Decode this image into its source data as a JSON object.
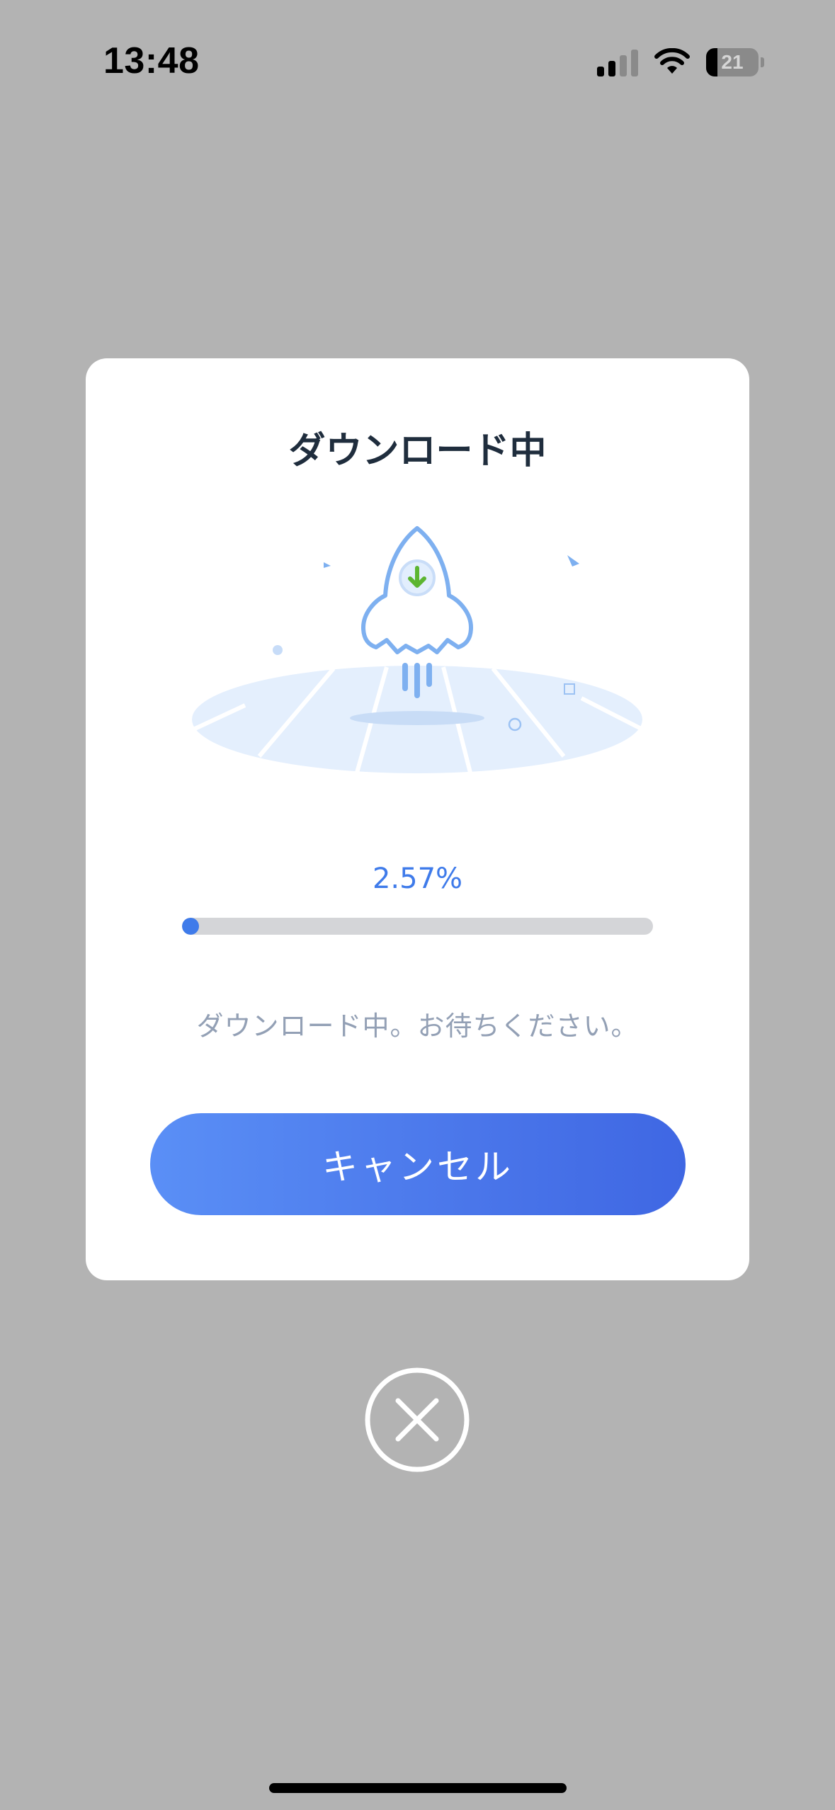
{
  "status_bar": {
    "time": "13:48",
    "battery_level": "21",
    "battery_fraction": 0.21
  },
  "dialog": {
    "title": "ダウンロード中",
    "progress_percent_text": "2.57%",
    "progress_fraction": 0.0257,
    "message": "ダウンロード中。お待ちください。",
    "cancel_label": "キャンセル"
  },
  "colors": {
    "accent": "#3f7bea",
    "rocket_outline": "#7eb0f0",
    "arrow_green": "#5cb531",
    "overlay": "#b3b3b3"
  },
  "icons": {
    "illustration": "rocket-download-illustration",
    "close": "close-icon",
    "signal": "cellular-signal-icon",
    "wifi": "wifi-icon",
    "battery": "battery-icon"
  }
}
